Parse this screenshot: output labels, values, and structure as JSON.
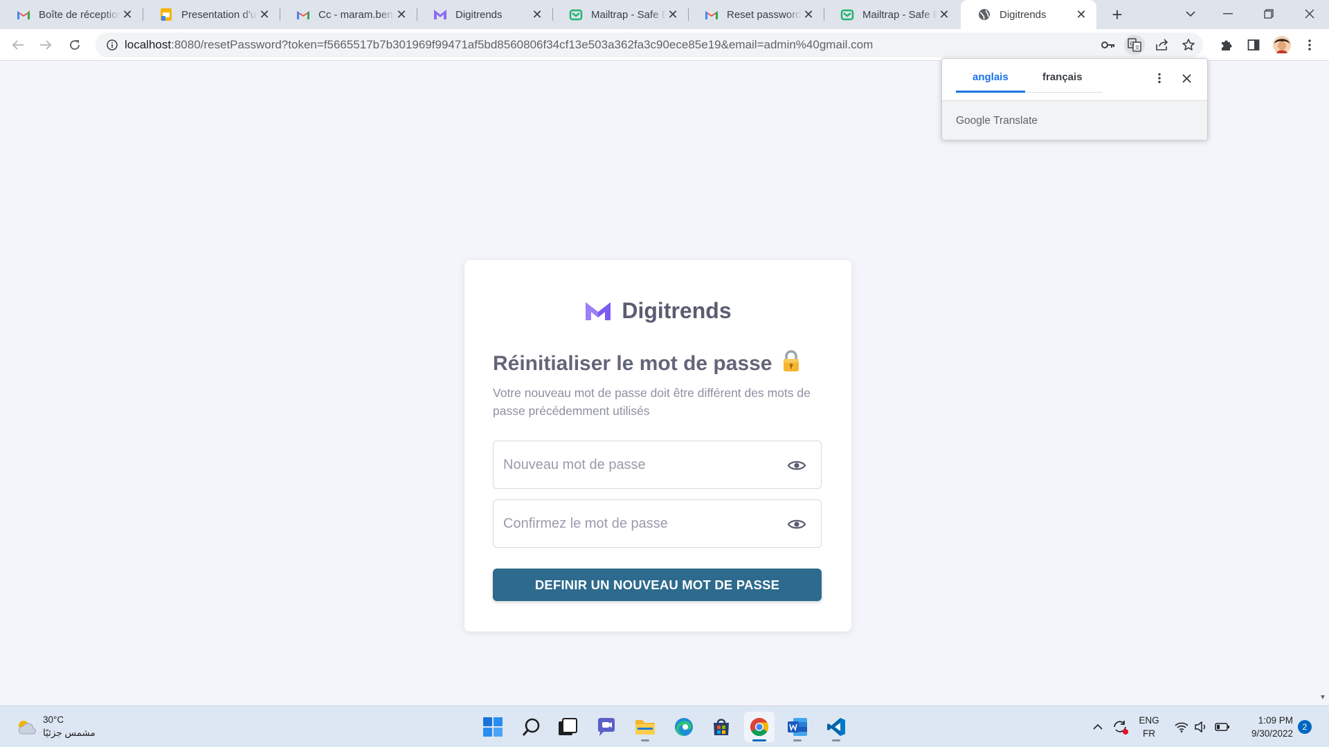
{
  "browser": {
    "tabs": [
      {
        "title": "Boîte de réception",
        "icon": "gmail-icon"
      },
      {
        "title": "Presentation d'une",
        "icon": "slides-icon"
      },
      {
        "title": "Cc - maram.benab",
        "icon": "gmail-icon"
      },
      {
        "title": "Digitrends",
        "icon": "digitrends-logo-icon"
      },
      {
        "title": "Mailtrap - Safe Em",
        "icon": "mailtrap-icon"
      },
      {
        "title": "Reset password in",
        "icon": "gmail-icon"
      },
      {
        "title": "Mailtrap - Safe Em",
        "icon": "mailtrap-icon"
      },
      {
        "title": "Digitrends",
        "icon": "globe-icon",
        "active": true
      }
    ],
    "new_tab_label": "+",
    "url_host": "localhost",
    "url_rest": ":8080/resetPassword?token=f5665517b7b301969f99471af5bd8560806f34cf13e503a362fa3c90ece85e19&email=admin%40gmail.com"
  },
  "translate_popup": {
    "source_language": "anglais",
    "target_language": "français",
    "brand_google": "Google",
    "brand_product": "Translate"
  },
  "page": {
    "brand_name": "Digitrends",
    "title": "Réinitialiser le mot de passe",
    "title_emoji": "🔒",
    "subtitle": "Votre nouveau mot de passe doit être différent des mots de passe précédemment utilisés",
    "new_password_placeholder": "Nouveau mot de passe",
    "confirm_password_placeholder": "Confirmez le mot de passe",
    "submit_label": "DEFINIR UN NOUVEAU MOT DE PASSE"
  },
  "taskbar": {
    "weather_temp": "30°C",
    "weather_desc": "مشمس جزئيًا",
    "language_top": "ENG",
    "language_bottom": "FR",
    "time": "1:09 PM",
    "date": "9/30/2022",
    "notification_count": "2"
  },
  "colors": {
    "accent_button": "#2d6a8d",
    "brand_purple": "#7c5cf0",
    "page_background": "#f4f5fa",
    "translate_blue": "#1a73e8"
  }
}
